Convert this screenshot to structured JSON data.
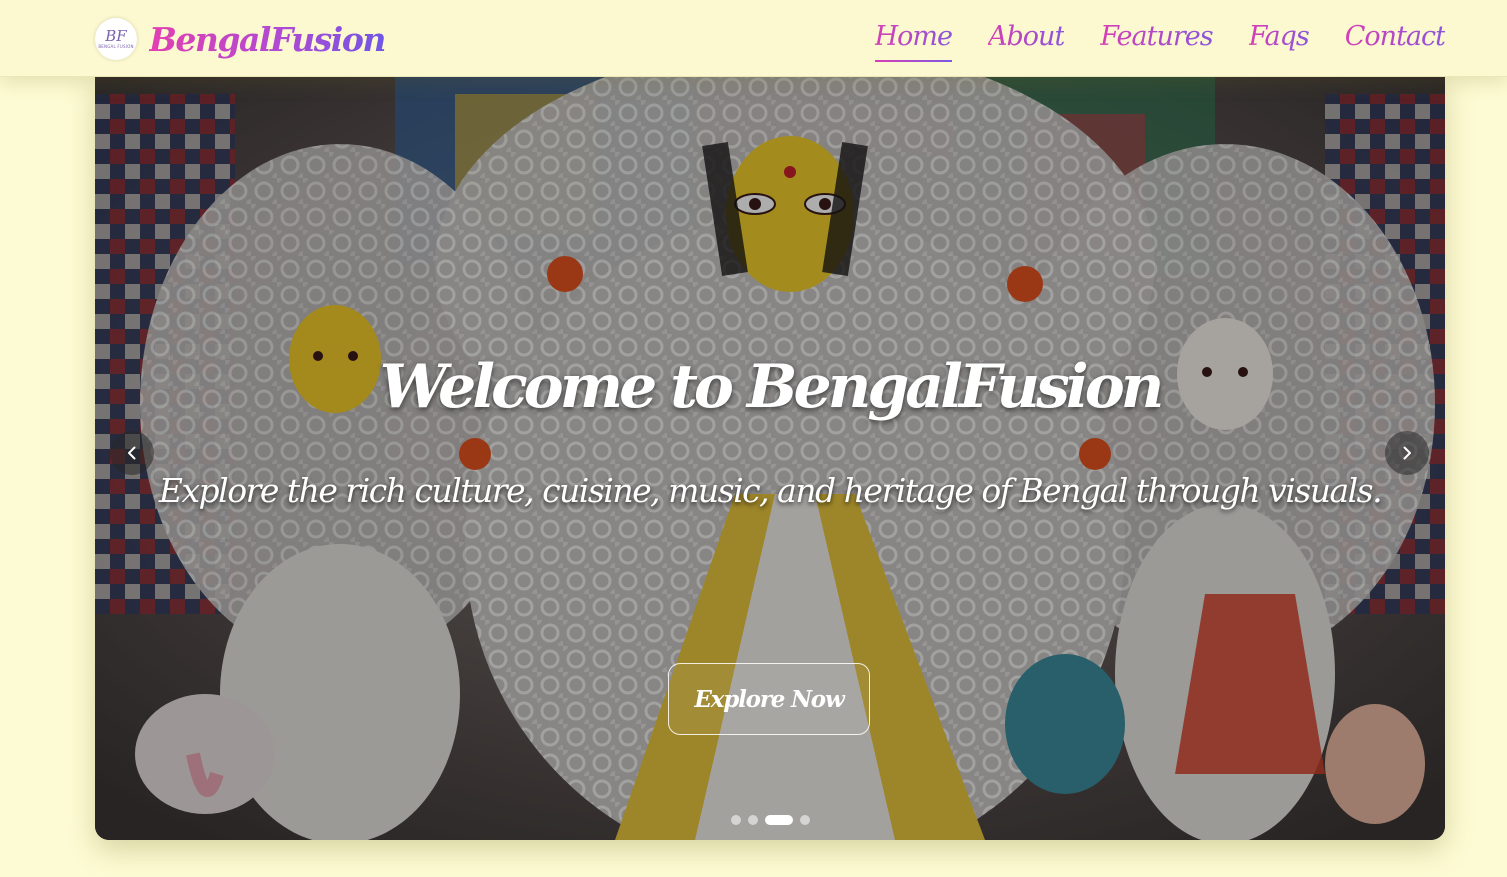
{
  "brand": {
    "logo_monogram": "BF",
    "logo_subtext": "BENGAL FUSION",
    "name": "BengalFusion"
  },
  "nav": {
    "items": [
      {
        "label": "Home",
        "active": true
      },
      {
        "label": "About",
        "active": false
      },
      {
        "label": "Features",
        "active": false
      },
      {
        "label": "Faqs",
        "active": false
      },
      {
        "label": "Contact",
        "active": false
      }
    ]
  },
  "hero": {
    "title": "Welcome to BengalFusion",
    "subtitle": "Explore the rich culture, cuisine, music, and heritage of Bengal through visuals.",
    "cta_label": "Explore Now",
    "slide_count": 4,
    "active_slide": 3,
    "image_subject": "Durga Puja idol photograph"
  },
  "icons": {
    "prev": "chevron-left-icon",
    "next": "chevron-right-icon"
  },
  "colors": {
    "page_background": "#fdfbd3",
    "brand_gradient_start": "#e23fb2",
    "brand_gradient_end": "#7056e6"
  }
}
